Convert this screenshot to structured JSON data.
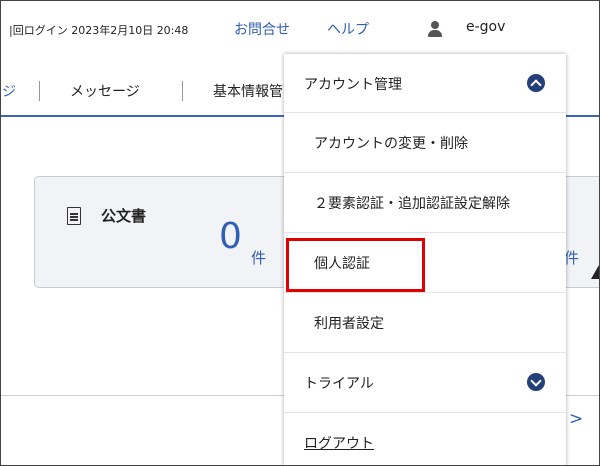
{
  "header": {
    "last_login": "|回ログイン 2023年2月10日 20:48",
    "contact_link": "お問合せ",
    "help_link": "ヘルプ",
    "user_name": "e-gov"
  },
  "nav": {
    "partial_item": "ジ",
    "items": [
      "メッセージ",
      "基本情報管"
    ]
  },
  "card": {
    "title": "公文書",
    "count": "0",
    "count_unit": "件",
    "count_unit_right": "件"
  },
  "dropdown": {
    "account_section": "アカウント管理",
    "items": [
      "アカウントの変更・削除",
      "２要素認証・追加認証設定解除",
      "個人認証",
      "利用者設定"
    ],
    "trial_section": "トライアル",
    "logout": "ログアウト"
  },
  "colors": {
    "accent": "#2f5fb3",
    "toggle_button": "#243f7a",
    "highlight": "#e00000"
  }
}
